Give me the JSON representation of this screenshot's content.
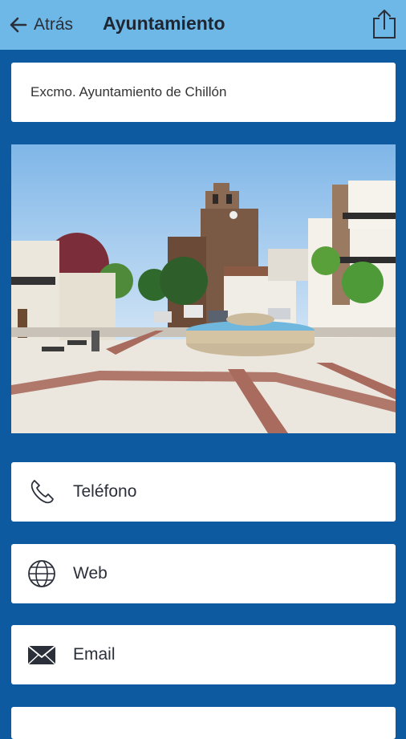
{
  "header": {
    "back_label": "Atrás",
    "title": "Ayuntamiento"
  },
  "entity_name": "Excmo. Ayuntamiento de Chillón",
  "photo": {
    "alt": "Plaza con fuente e iglesia"
  },
  "actions": [
    {
      "label": "Teléfono",
      "icon": "phone-icon"
    },
    {
      "label": "Web",
      "icon": "globe-icon"
    },
    {
      "label": "Email",
      "icon": "envelope-icon"
    }
  ],
  "colors": {
    "header_bg": "#6db8e6",
    "page_bg": "#0d5aa0",
    "card_bg": "#ffffff"
  }
}
